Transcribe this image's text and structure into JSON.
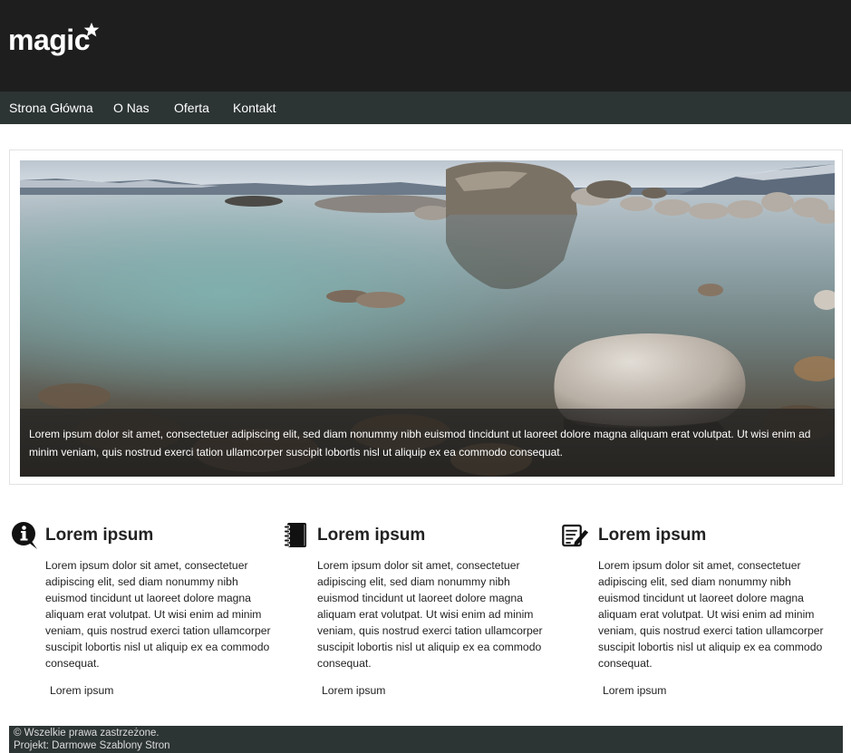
{
  "header": {
    "logo_text": "magic",
    "logo_icon": "star-icon"
  },
  "nav": {
    "items": [
      {
        "label": "Strona Główna"
      },
      {
        "label": "O Nas"
      },
      {
        "label": "Oferta"
      },
      {
        "label": "Kontakt"
      }
    ]
  },
  "slider": {
    "caption": "Lorem ipsum dolor sit amet, consectetuer adipiscing elit, sed diam nonummy nibh euismod tincidunt ut laoreet dolore magna aliquam erat volutpat. Ut wisi enim ad minim veniam, quis nostrud exerci tation ullamcorper suscipit lobortis nisl ut aliquip ex ea commodo consequat."
  },
  "columns": [
    {
      "icon": "info-speech-icon",
      "title": "Lorem ipsum",
      "text": "Lorem ipsum dolor sit amet, consectetuer adipiscing elit, sed diam nonummy nibh euismod tincidunt ut laoreet dolore magna aliquam erat volutpat. Ut wisi enim ad minim veniam, quis nostrud exerci tation ullamcorper suscipit lobortis nisl ut aliquip ex ea commodo consequat.",
      "link": "Lorem ipsum"
    },
    {
      "icon": "notebook-icon",
      "title": "Lorem ipsum",
      "text": "Lorem ipsum dolor sit amet, consectetuer adipiscing elit, sed diam nonummy nibh euismod tincidunt ut laoreet dolore magna aliquam erat volutpat. Ut wisi enim ad minim veniam, quis nostrud exerci tation ullamcorper suscipit lobortis nisl ut aliquip ex ea commodo consequat.",
      "link": "Lorem ipsum"
    },
    {
      "icon": "document-pen-icon",
      "title": "Lorem ipsum",
      "text": "Lorem ipsum dolor sit amet, consectetuer adipiscing elit, sed diam nonummy nibh euismod tincidunt ut laoreet dolore magna aliquam erat volutpat. Ut wisi enim ad minim veniam, quis nostrud exerci tation ullamcorper suscipit lobortis nisl ut aliquip ex ea commodo consequat.",
      "link": "Lorem ipsum"
    }
  ],
  "footer": {
    "copyright": "© Wszelkie prawa zastrzeżone.",
    "credit": "Projekt: Darmowe Szablony Stron"
  },
  "colors": {
    "header_bg": "#1e1e1e",
    "nav_bg": "#2d3434",
    "text": "#222222"
  }
}
